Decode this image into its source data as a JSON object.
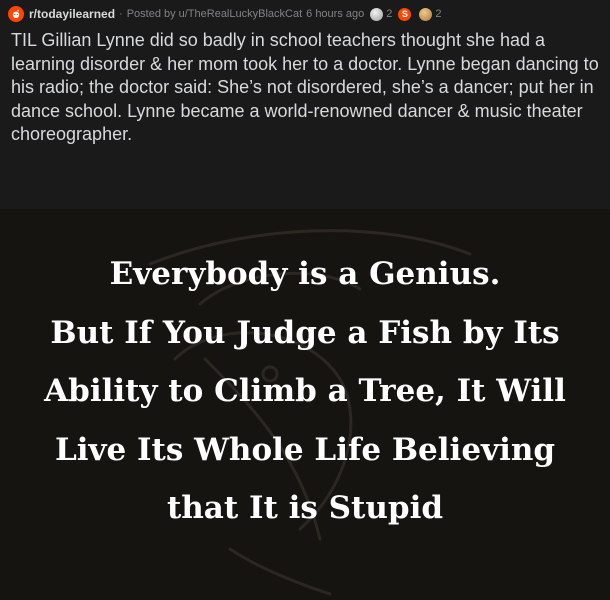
{
  "post": {
    "subreddit": "r/todayilearned",
    "separator": "·",
    "posted_by_prefix": "Posted by",
    "author": "u/TheRealLuckyBlackCat",
    "time_ago": "6 hours ago",
    "awards": [
      {
        "icon": "silver-award-icon",
        "count": "2",
        "color": "#c0c0c0"
      },
      {
        "icon": "helpful-award-icon",
        "count": "",
        "color": "#ff4500"
      },
      {
        "icon": "wholesome-award-icon",
        "count": "2",
        "color": "#d4a35a"
      }
    ],
    "title": "TIL Gillian Lynne did so badly in school teachers thought she had a learning disorder & her mom took her to a doctor. Lynne began dancing to his radio; the doctor said: She’s not disordered, she’s a dancer; put her in dance school. Lynne became a world-renowned dancer & music theater choreographer."
  },
  "image": {
    "quote_lines": [
      "Everybody is a Genius.",
      "But If You Judge a Fish by Its",
      "Ability to Climb a Tree, It Will",
      "Live Its Whole Life Believing",
      "that It is Stupid"
    ],
    "background_color": "#161411",
    "text_color": "#ffffff"
  },
  "colors": {
    "brand": "#ff4500",
    "title_text": "#d7dadc",
    "meta_text": "#818384",
    "header_bg": "#1a1a1b"
  }
}
